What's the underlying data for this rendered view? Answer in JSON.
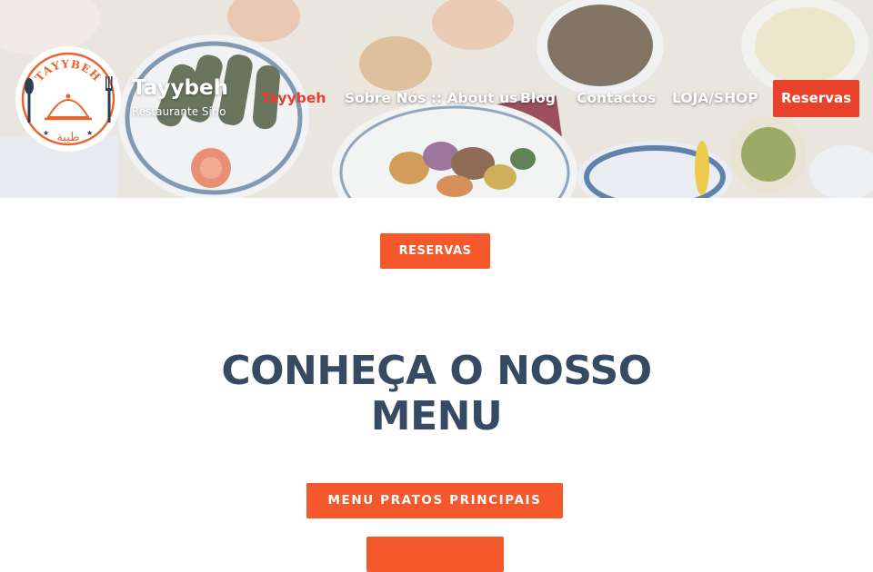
{
  "site": {
    "logo_text": "TAYYBEH",
    "logo_script": "طيبة",
    "title": "Tayybeh",
    "tagline": "Restaurante Sírio"
  },
  "nav": {
    "items": [
      {
        "label": "Tayybeh",
        "active": true
      },
      {
        "label": "Sobre Nós :: About us",
        "active": false
      },
      {
        "label": "Blog",
        "active": false
      },
      {
        "label": "Contactos",
        "active": false
      },
      {
        "label": "LOJA/SHOP",
        "active": false
      }
    ],
    "cta_label": "Reservas"
  },
  "main": {
    "reservas_button": "RESERVAS",
    "heading": "CONHEÇA O NOSSO MENU",
    "menu_button": "MENU PRATOS PRINCIPAIS"
  },
  "colors": {
    "accent": "#f4582b",
    "nav_active": "#e8402a",
    "heading": "#374a63"
  }
}
